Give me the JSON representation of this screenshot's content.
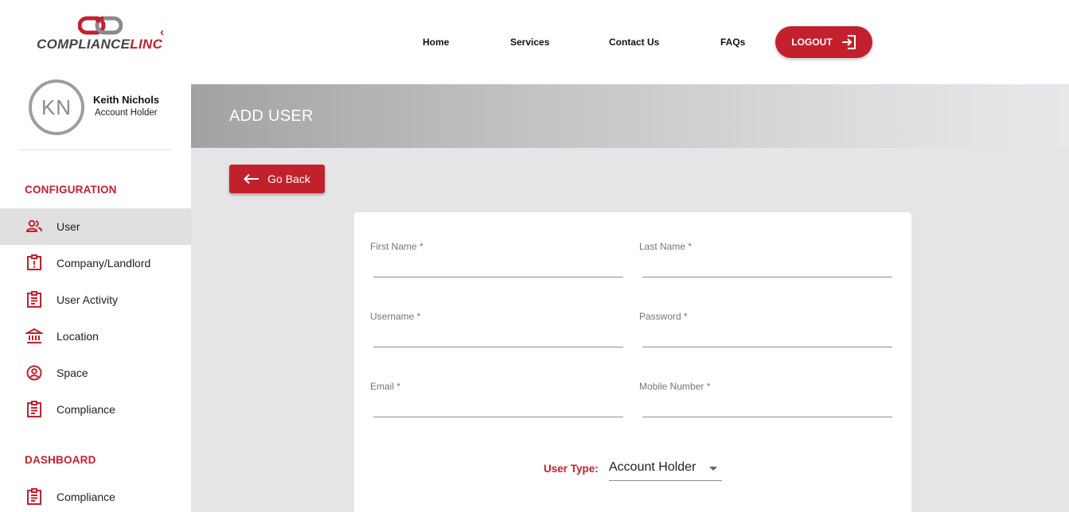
{
  "brand": {
    "name_prefix": "COMPLIANCE",
    "name_suffix": "LINC",
    "accent_color": "#c3202d"
  },
  "nav": {
    "items": [
      "Home",
      "Services",
      "Contact Us",
      "FAQs"
    ],
    "logout_label": "LOGOUT"
  },
  "user": {
    "initials": "KN",
    "name": "Keith Nichols",
    "role": "Account Holder"
  },
  "sidebar": {
    "configuration_title": "CONFIGURATION",
    "configuration_items": [
      {
        "label": "User",
        "icon": "people-icon",
        "active": true
      },
      {
        "label": "Company/Landlord",
        "icon": "alert-box-icon",
        "active": false
      },
      {
        "label": "User Activity",
        "icon": "clipboard-list-icon",
        "active": false
      },
      {
        "label": "Location",
        "icon": "bank-icon",
        "active": false
      },
      {
        "label": "Space",
        "icon": "account-circle-icon",
        "active": false
      },
      {
        "label": "Compliance",
        "icon": "clipboard-list-icon",
        "active": false
      }
    ],
    "dashboard_title": "DASHBOARD",
    "dashboard_items": [
      {
        "label": "Compliance",
        "icon": "clipboard-list-icon",
        "active": false
      }
    ]
  },
  "page": {
    "title": "ADD USER",
    "go_back_label": "Go Back"
  },
  "form": {
    "first_name": {
      "label": "First Name *",
      "value": ""
    },
    "last_name": {
      "label": "Last Name *",
      "value": ""
    },
    "username": {
      "label": "Username *",
      "value": ""
    },
    "password": {
      "label": "Password *",
      "value": ""
    },
    "email": {
      "label": "Email *",
      "value": ""
    },
    "mobile_number": {
      "label": "Mobile Number *",
      "value": ""
    },
    "user_type": {
      "label": "User Type:",
      "value": "Account Holder"
    }
  }
}
